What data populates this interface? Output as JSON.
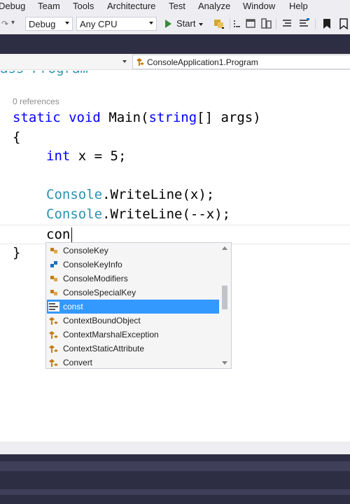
{
  "menu": [
    "Debug",
    "Team",
    "Tools",
    "Architecture",
    "Test",
    "Analyze",
    "Window",
    "Help"
  ],
  "toolbar": {
    "config_value": "Debug",
    "platform_value": "Any CPU",
    "start_label": "Start"
  },
  "navbar": {
    "member_value": "ConsoleApplication1.Program"
  },
  "code": {
    "partial_top": "ass Program",
    "codelens": "0 references",
    "line_static": "static",
    "line_void": "void",
    "line_main": "Main(",
    "line_string": "string",
    "line_args": "[] args)",
    "open_brace": "{",
    "int_kw": "int",
    "int_rest": " x = 5;",
    "console1": "Console",
    "writeline1": ".WriteLine(x);",
    "console2": "Console",
    "writeline2": ".WriteLine(--x);",
    "typed": "con",
    "close_brace": "}"
  },
  "completion": {
    "items": [
      {
        "label": "ConsoleKey",
        "icon": "enum-icon"
      },
      {
        "label": "ConsoleKeyInfo",
        "icon": "struct-icon"
      },
      {
        "label": "ConsoleModifiers",
        "icon": "enum-icon"
      },
      {
        "label": "ConsoleSpecialKey",
        "icon": "enum-icon"
      },
      {
        "label": "const",
        "icon": "keyword-icon",
        "selected": true
      },
      {
        "label": "ContextBoundObject",
        "icon": "class-icon"
      },
      {
        "label": "ContextMarshalException",
        "icon": "class-icon"
      },
      {
        "label": "ContextStaticAttribute",
        "icon": "class-icon"
      },
      {
        "label": "Convert",
        "icon": "class-icon"
      }
    ]
  },
  "colors": {
    "keyword": "#0000ff",
    "type": "#2b91af",
    "selection": "#3399ff",
    "chrome_dark": "#2d2d43",
    "start_green": "#388a34"
  }
}
